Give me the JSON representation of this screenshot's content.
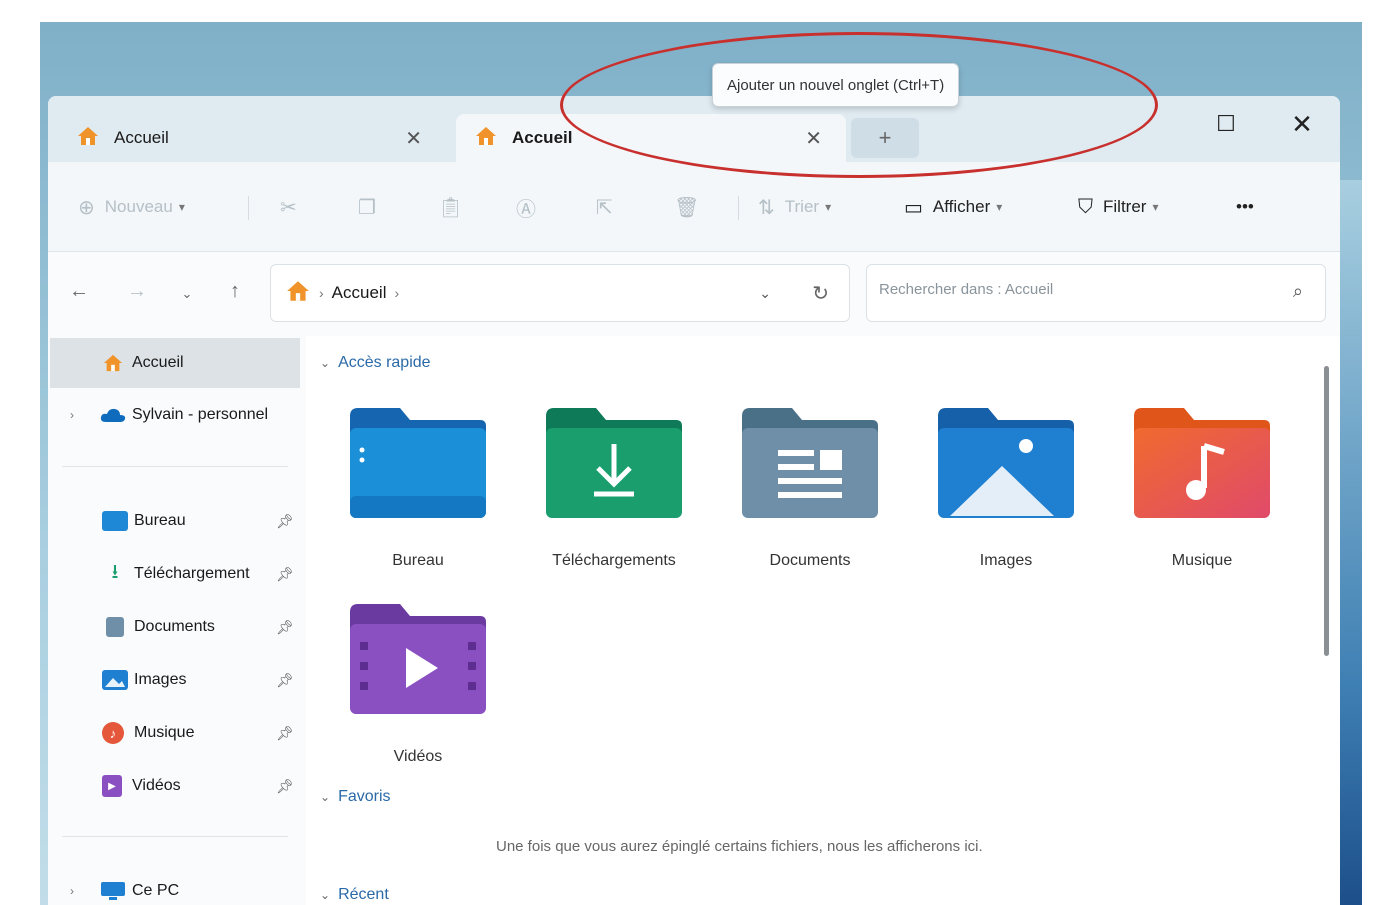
{
  "tooltip": {
    "text": "Ajouter un nouvel onglet (Ctrl+T)"
  },
  "tabs": [
    {
      "label": "Accueil",
      "active": false
    },
    {
      "label": "Accueil",
      "active": true
    }
  ],
  "tab_close_glyph": "✕",
  "new_tab_glyph": "+",
  "window_controls": {
    "maximize": "☐",
    "close": "✕"
  },
  "commandbar": {
    "new_label": "Nouveau",
    "sort_label": "Trier",
    "view_label": "Afficher",
    "filter_label": "Filtrer",
    "more_label": "•••"
  },
  "address": {
    "crumb": "Accueil",
    "search_placeholder": "Rechercher dans : Accueil"
  },
  "sidebar": {
    "top": [
      {
        "label": "Accueil",
        "icon": "home-icon"
      },
      {
        "label": "Sylvain - personnel",
        "icon": "onedrive-cloud-icon"
      }
    ],
    "pinned": [
      {
        "label": "Bureau",
        "icon": "desktop-folder-icon",
        "color": "#1e88d6"
      },
      {
        "label": "Téléchargement",
        "icon": "download-icon",
        "color": "#1a9e6e"
      },
      {
        "label": "Documents",
        "icon": "documents-icon",
        "color": "#6f8fa8"
      },
      {
        "label": "Images",
        "icon": "pictures-icon",
        "color": "#1f7fd0"
      },
      {
        "label": "Musique",
        "icon": "music-icon",
        "color": "#e5573a"
      },
      {
        "label": "Vidéos",
        "icon": "videos-icon",
        "color": "#8a4fc0"
      }
    ],
    "bottom": [
      {
        "label": "Ce PC",
        "icon": "this-pc-icon"
      }
    ]
  },
  "main": {
    "quick_access_label": "Accès rapide",
    "favorites_label": "Favoris",
    "recent_label": "Récent",
    "favorites_empty": "Une fois que vous aurez épinglé certains fichiers, nous les afficherons ici.",
    "folders": [
      {
        "label": "Bureau",
        "icon": "desktop-folder-icon"
      },
      {
        "label": "Téléchargements",
        "icon": "download-folder-icon"
      },
      {
        "label": "Documents",
        "icon": "documents-folder-icon"
      },
      {
        "label": "Images",
        "icon": "pictures-folder-icon"
      },
      {
        "label": "Musique",
        "icon": "music-folder-icon"
      },
      {
        "label": "Vidéos",
        "icon": "videos-folder-icon"
      }
    ]
  },
  "colors": {
    "accent": "#2b6aa8",
    "annotation": "#c8302e"
  }
}
